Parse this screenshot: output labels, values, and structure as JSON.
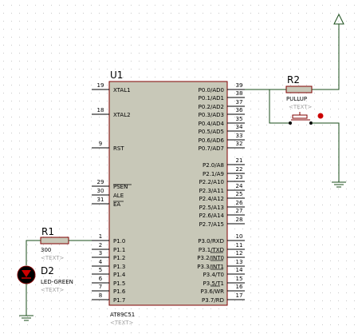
{
  "colors": {
    "background": "#ffffff",
    "grid_dot": "#c8c8c8",
    "chip_fill": "#c8c8b8",
    "chip_border": "#800000",
    "wire": "#1a4d1a",
    "pin": "#000000",
    "led_red": "#cc0000",
    "text": "#000000",
    "placeholder_text": "#a0a0a0"
  },
  "mcu": {
    "ref": "U1",
    "model": "AT89C51",
    "text_tag": "<TEXT>",
    "left_pins": [
      {
        "num": "19",
        "label": "XTAL1"
      },
      {
        "num": "18",
        "label": "XTAL2"
      },
      {
        "num": "9",
        "label": "RST"
      },
      {
        "num": "29",
        "label": "PSEN"
      },
      {
        "num": "30",
        "label": "ALE"
      },
      {
        "num": "31",
        "label": "EA"
      },
      {
        "num": "1",
        "label": "P1.0"
      },
      {
        "num": "2",
        "label": "P1.1"
      },
      {
        "num": "3",
        "label": "P1.2"
      },
      {
        "num": "4",
        "label": "P1.3"
      },
      {
        "num": "5",
        "label": "P1.4"
      },
      {
        "num": "6",
        "label": "P1.5"
      },
      {
        "num": "7",
        "label": "P1.6"
      },
      {
        "num": "8",
        "label": "P1.7"
      }
    ],
    "right_pins": [
      {
        "num": "39",
        "label": "P0.0/AD0"
      },
      {
        "num": "38",
        "label": "P0.1/AD1"
      },
      {
        "num": "37",
        "label": "P0.2/AD2"
      },
      {
        "num": "36",
        "label": "P0.3/AD3"
      },
      {
        "num": "35",
        "label": "P0.4/AD4"
      },
      {
        "num": "34",
        "label": "P0.5/AD5"
      },
      {
        "num": "33",
        "label": "P0.6/AD6"
      },
      {
        "num": "32",
        "label": "P0.7/AD7"
      },
      {
        "num": "21",
        "label": "P2.0/A8"
      },
      {
        "num": "22",
        "label": "P2.1/A9"
      },
      {
        "num": "23",
        "label": "P2.2/A10"
      },
      {
        "num": "24",
        "label": "P2.3/A11"
      },
      {
        "num": "25",
        "label": "P2.4/A12"
      },
      {
        "num": "26",
        "label": "P2.5/A13"
      },
      {
        "num": "27",
        "label": "P2.6/A14"
      },
      {
        "num": "28",
        "label": "P2.7/A15"
      },
      {
        "num": "10",
        "label": "P3.0/RXD"
      },
      {
        "num": "11",
        "label": "P3.1/TXD"
      },
      {
        "num": "12",
        "label": "P3.2/INT0"
      },
      {
        "num": "13",
        "label": "P3.3/INT1"
      },
      {
        "num": "14",
        "label": "P3.4/T0"
      },
      {
        "num": "15",
        "label": "P3.5/T1"
      },
      {
        "num": "16",
        "label": "P3.6/WR"
      },
      {
        "num": "17",
        "label": "P3.7/RD"
      }
    ]
  },
  "r1": {
    "ref": "R1",
    "value": "300",
    "text_tag": "<TEXT>"
  },
  "d2": {
    "ref": "D2",
    "value": "LED-GREEN",
    "text_tag": "<TEXT>"
  },
  "r2": {
    "ref": "R2",
    "value": "PULLUP",
    "text_tag": "<TEXT>"
  }
}
